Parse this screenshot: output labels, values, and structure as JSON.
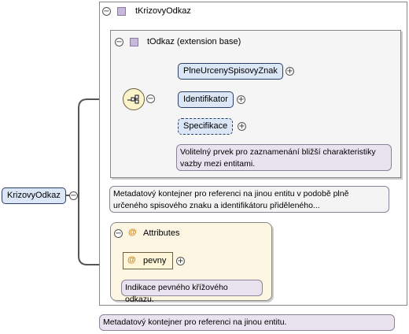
{
  "root": {
    "label": "KrizovyOdkaz"
  },
  "type": {
    "label": "tKrizovyOdkaz"
  },
  "base": {
    "label": "tOdkaz (extension base)"
  },
  "sequence": {
    "elements": [
      {
        "label": "PlneUrcenySpisovyZnak",
        "optional": false
      },
      {
        "label": "Identifikator",
        "optional": false
      },
      {
        "label": "Specifikace",
        "optional": true
      }
    ],
    "specifikace_note": [
      "Volitelný prvek pro zaznamenání bližší charakteristiky",
      "vazby mezi entitami."
    ]
  },
  "base_note": [
    "Metadatový kontejner pro referenci na jinou entitu v podobě plně",
    "určeného spisového znaku a identifikátoru přiděleného..."
  ],
  "attributes": {
    "label": "Attributes",
    "at_symbol": "@",
    "items": [
      {
        "label": "pevny",
        "note": "Indikace pevného křížového odkazu."
      }
    ]
  },
  "root_note": "Metadatový kontejner pro referenci na jinou entitu.",
  "symbols": {
    "expand": "−",
    "collapse": "+"
  },
  "colors": {
    "connector": "#555555",
    "element_fill": "#dbe7f7",
    "attr_fill": "#fdf6e3",
    "note_fill": "#e9e2ef"
  }
}
